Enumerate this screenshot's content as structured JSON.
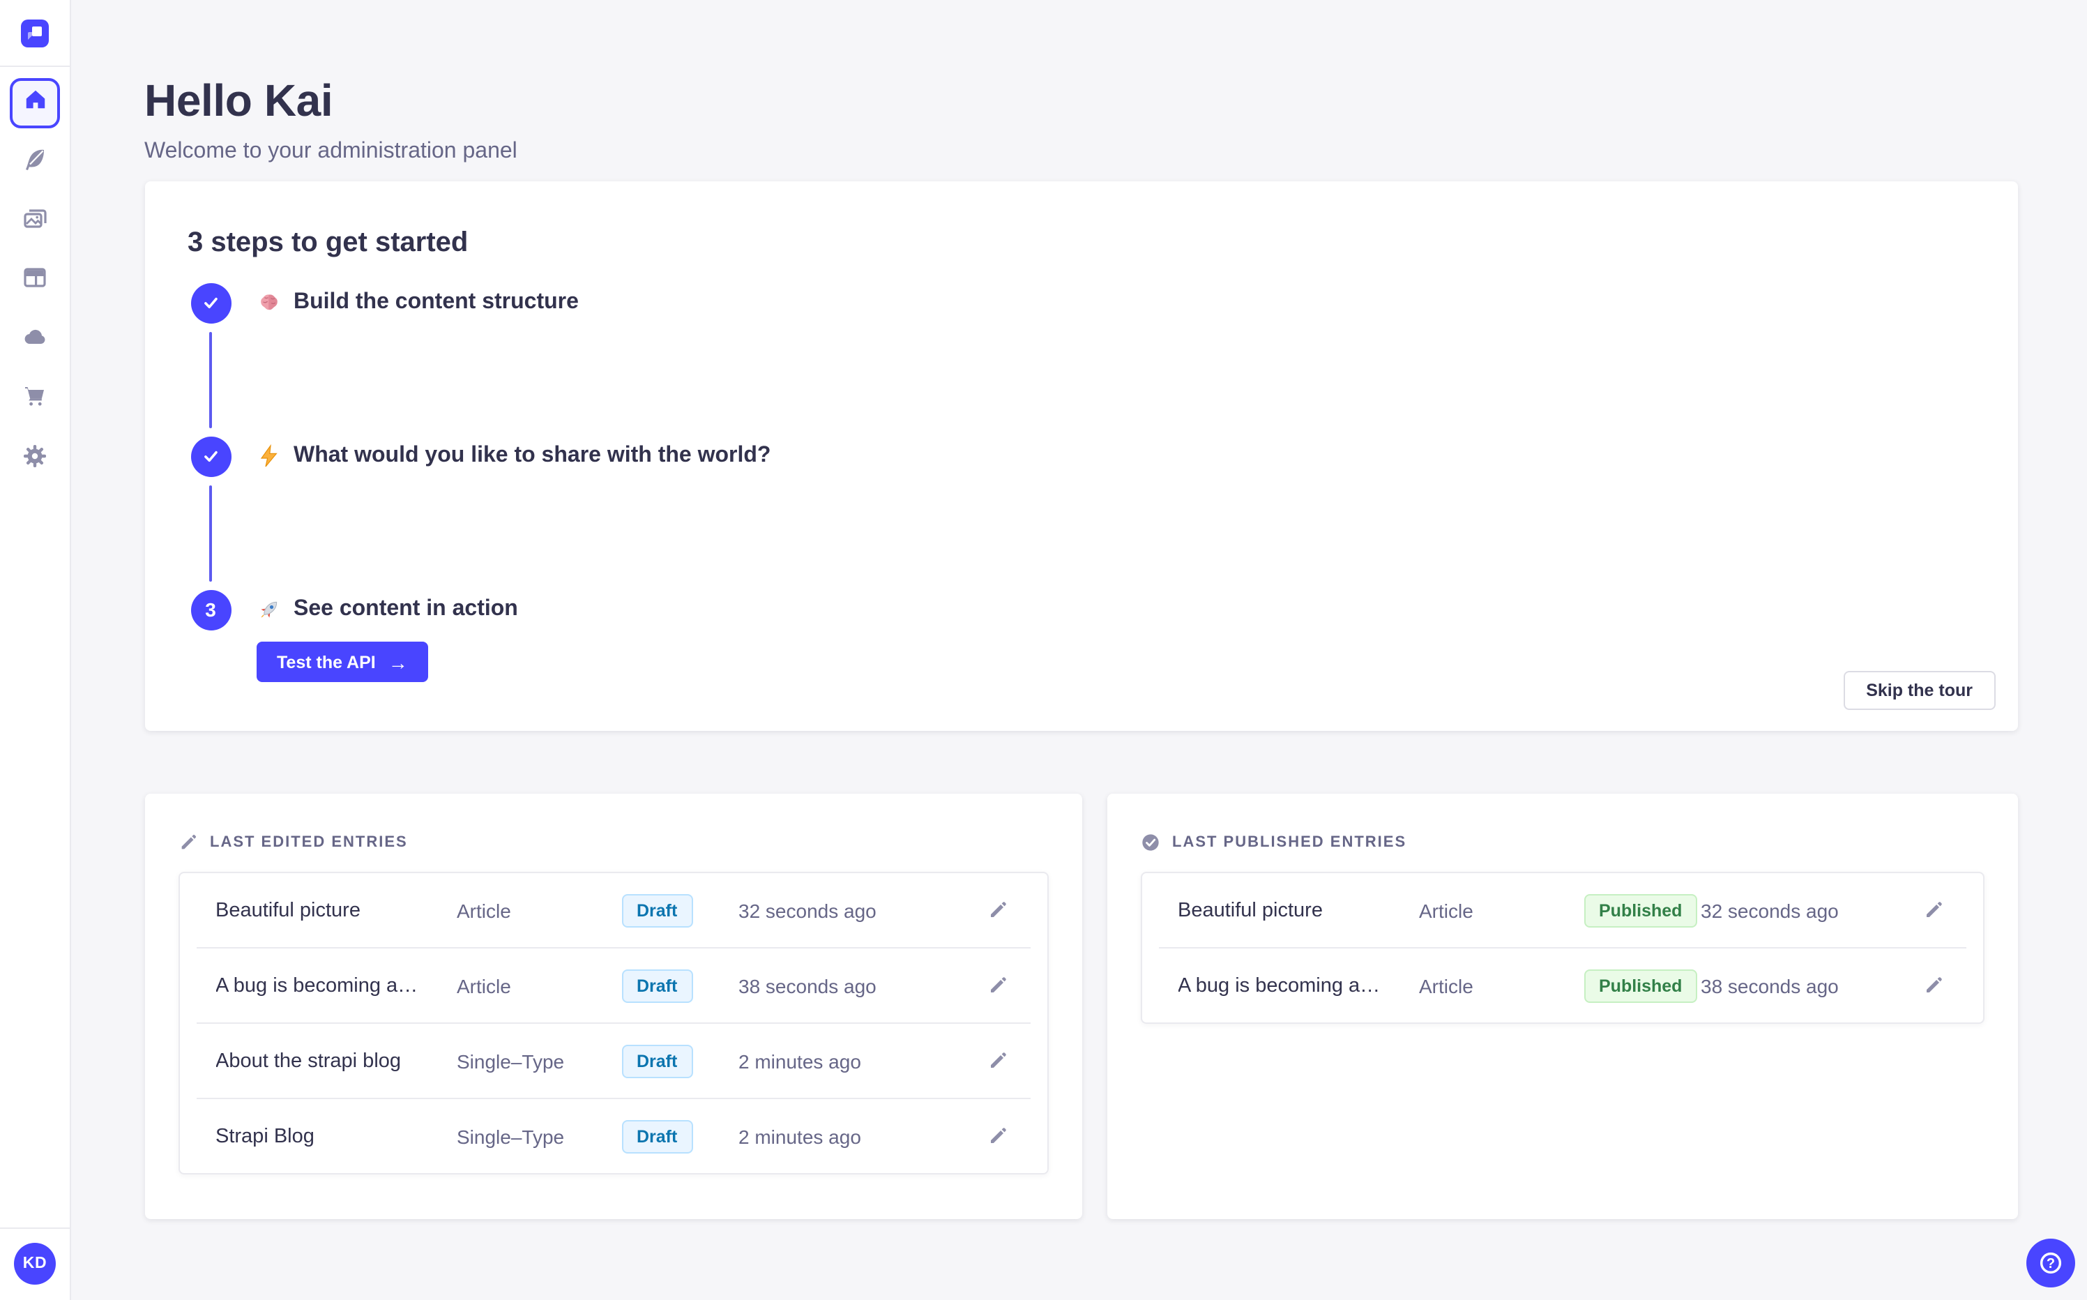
{
  "sidebar": {
    "logo_icon": "strapi-logo",
    "items": [
      {
        "name": "home",
        "icon": "home-icon",
        "active": true
      },
      {
        "name": "content-manager",
        "icon": "feather-icon",
        "active": false
      },
      {
        "name": "media-library",
        "icon": "images-icon",
        "active": false
      },
      {
        "name": "content-type-builder",
        "icon": "layout-icon",
        "active": false
      },
      {
        "name": "cloud",
        "icon": "cloud-icon",
        "active": false
      },
      {
        "name": "marketplace",
        "icon": "cart-icon",
        "active": false
      },
      {
        "name": "settings",
        "icon": "gear-icon",
        "active": false
      }
    ],
    "avatar_initials": "KD"
  },
  "header": {
    "title": "Hello Kai",
    "subtitle": "Welcome to your administration panel"
  },
  "onboarding": {
    "title": "3 steps to get started",
    "steps": [
      {
        "number": "1",
        "done": true,
        "emoji": "brain-emoji",
        "label": "Build the content structure"
      },
      {
        "number": "2",
        "done": true,
        "emoji": "lightning-emoji",
        "label": "What would you like to share with the world?"
      },
      {
        "number": "3",
        "done": false,
        "emoji": "rocket-emoji",
        "label": "See content in action"
      }
    ],
    "test_api_label": "Test the API",
    "skip_label": "Skip the tour"
  },
  "panels": {
    "edited": {
      "title": "LAST EDITED ENTRIES",
      "icon": "pencil-icon",
      "rows": [
        {
          "title": "Beautiful picture",
          "type": "Article",
          "status": "Draft",
          "time": "32 seconds ago"
        },
        {
          "title": "A bug is becoming a…",
          "type": "Article",
          "status": "Draft",
          "time": "38 seconds ago"
        },
        {
          "title": "About the strapi blog",
          "type": "Single–Type",
          "status": "Draft",
          "time": "2 minutes ago"
        },
        {
          "title": "Strapi Blog",
          "type": "Single–Type",
          "status": "Draft",
          "time": "2 minutes ago"
        }
      ]
    },
    "published": {
      "title": "LAST PUBLISHED ENTRIES",
      "icon": "check-circle-icon",
      "rows": [
        {
          "title": "Beautiful picture",
          "type": "Article",
          "status": "Published",
          "time": "32 seconds ago"
        },
        {
          "title": "A bug is becoming a…",
          "type": "Article",
          "status": "Published",
          "time": "38 seconds ago"
        }
      ]
    }
  },
  "colors": {
    "primary": "#4945ff",
    "text_dark": "#32324d",
    "text_gray": "#666687",
    "draft_text": "#0c75af",
    "published_text": "#328048",
    "background": "#f6f6f9"
  },
  "help_label": "?"
}
